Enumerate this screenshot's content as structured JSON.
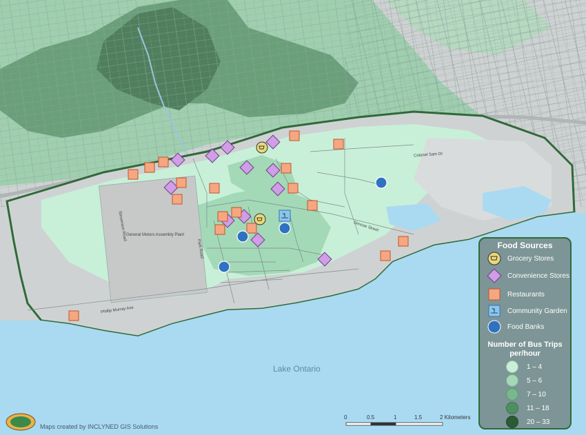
{
  "legend": {
    "title": "Food Sources",
    "items": [
      {
        "label": "Grocery Stores",
        "icon": "cart-icon"
      },
      {
        "label": "Convenience Stores",
        "icon": "convenience-store-icon"
      },
      {
        "label": "Restaurants",
        "icon": "restaurant-icon"
      },
      {
        "label": "Community Garden",
        "icon": "garden-icon"
      },
      {
        "label": "Food Banks",
        "icon": "food-bank-icon"
      }
    ],
    "bus_title": "Number of Bus Trips per/hour",
    "bus_classes": [
      {
        "label": "1 – 4",
        "color": "#c8f0d8"
      },
      {
        "label": "5 – 6",
        "color": "#a3d9b7"
      },
      {
        "label": "7 – 10",
        "color": "#77b88f"
      },
      {
        "label": "11 – 18",
        "color": "#4e8f62"
      },
      {
        "label": "20 – 33",
        "color": "#2b5a36"
      }
    ]
  },
  "map_labels": {
    "lake": "Lake Ontario",
    "plant": "General Motors Assembly Plant",
    "colonel_sam": "Colonel Sam Dr",
    "simcoe": "Simcoe Street",
    "phillip_murray": "Phillip Murray Ave",
    "stevenson": "Stevenson Road",
    "park": "Park Road"
  },
  "scale": {
    "ticks": [
      "0",
      "0.5",
      "1",
      "1.5",
      "2 Kilometers"
    ]
  },
  "credit": {
    "text": "Maps created by INCLYNED GIS Solutions"
  },
  "colors": {
    "water": "#a9daf2",
    "outline": "#2e6a38",
    "urban": "#cccfcf",
    "convenience": "#cf9ee6",
    "restaurant": "#f5a782",
    "grocery": "#e9d97a",
    "foodbank": "#2f72c2"
  }
}
